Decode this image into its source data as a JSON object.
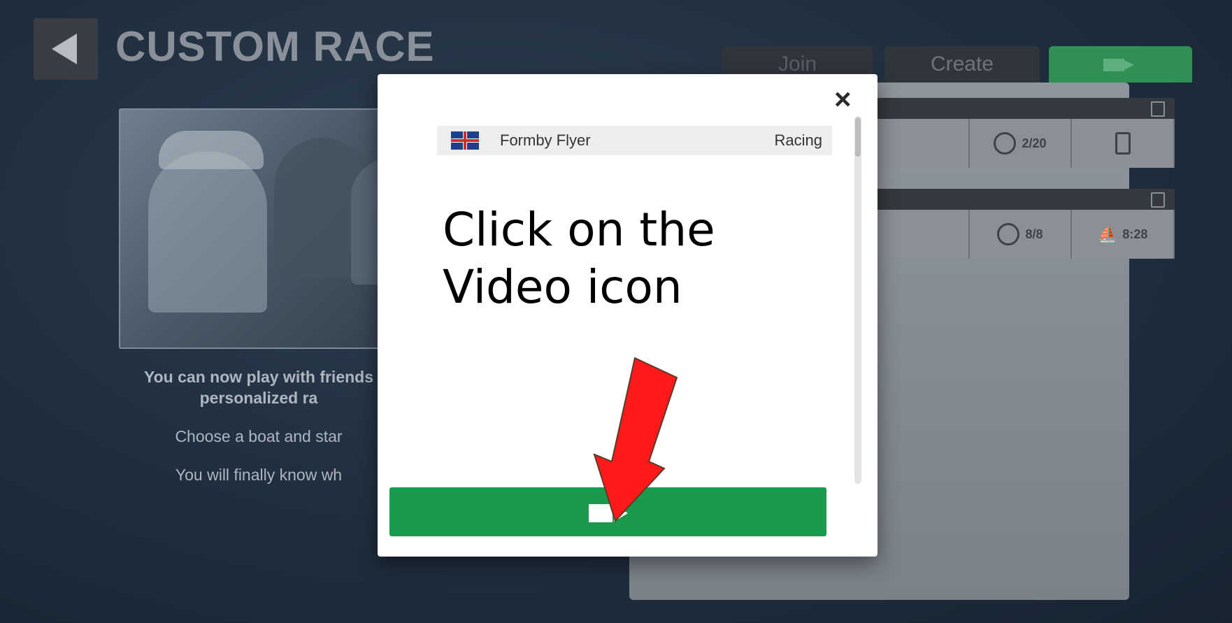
{
  "header": {
    "title": "CUSTOM RACE"
  },
  "intro": {
    "lead_line1": "You can now play with friends",
    "lead_line2": "personalized ra",
    "line2": "Choose a boat and star",
    "line3": "You will finally know wh"
  },
  "tabs": [
    {
      "label": "Join"
    },
    {
      "label": "Create"
    },
    {
      "label": "",
      "icon": "video-camera-icon"
    }
  ],
  "races": [
    {
      "players": "2/20",
      "status_icon": "hourglass-icon"
    },
    {
      "players": "8/8",
      "time": "8:28"
    }
  ],
  "modal": {
    "close_label": "×",
    "user": {
      "name": "Formby Flyer",
      "status": "Racing",
      "flag": "uk-flag-icon"
    },
    "instruction": "Click on the Video icon",
    "action_icon": "video-camera-icon"
  },
  "colors": {
    "accent": "#1a9b4b",
    "arrow": "#ff0000",
    "background": "#1f2e3e"
  }
}
